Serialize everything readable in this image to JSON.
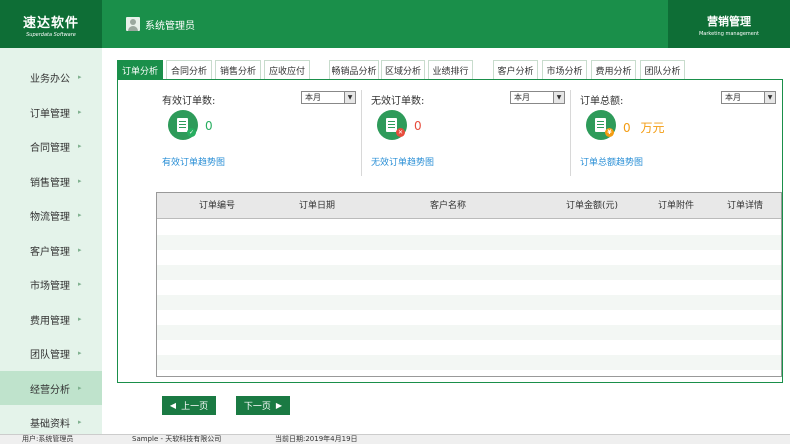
{
  "header": {
    "logo_title": "速达软件",
    "logo_subtitle": "Superdata Software",
    "user_label": "系统管理员",
    "module_title": "营销管理",
    "module_subtitle": "Marketing management"
  },
  "sidebar": {
    "items": [
      {
        "label": "业务办公",
        "active": false
      },
      {
        "label": "订单管理",
        "active": false
      },
      {
        "label": "合同管理",
        "active": false
      },
      {
        "label": "销售管理",
        "active": false
      },
      {
        "label": "物流管理",
        "active": false
      },
      {
        "label": "客户管理",
        "active": false
      },
      {
        "label": "市场管理",
        "active": false
      },
      {
        "label": "费用管理",
        "active": false
      },
      {
        "label": "团队管理",
        "active": false
      },
      {
        "label": "经营分析",
        "active": true
      },
      {
        "label": "基础资料",
        "active": false
      }
    ],
    "arrow": "▸"
  },
  "tabs": [
    {
      "label": "订单分析",
      "active": true
    },
    {
      "label": "合同分析",
      "active": false
    },
    {
      "label": "销售分析",
      "active": false
    },
    {
      "label": "应收应付",
      "active": false
    },
    {
      "label": "畅销品分析",
      "active": false
    },
    {
      "label": "区域分析",
      "active": false
    },
    {
      "label": "业绩排行",
      "active": false
    },
    {
      "label": "客户分析",
      "active": false
    },
    {
      "label": "市场分析",
      "active": false
    },
    {
      "label": "费用分析",
      "active": false
    },
    {
      "label": "团队分析",
      "active": false
    }
  ],
  "metrics": [
    {
      "label": "有效订单数:",
      "period": "本月",
      "value": "0",
      "unit": "",
      "link": "有效订单趋势图",
      "icon": "valid-order-icon",
      "badge": "✓",
      "value_color": "#27ae60"
    },
    {
      "label": "无效订单数:",
      "period": "本月",
      "value": "0",
      "unit": "",
      "link": "无效订单趋势图",
      "icon": "invalid-order-icon",
      "badge": "✕",
      "value_color": "#e74c3c"
    },
    {
      "label": "订单总额:",
      "period": "本月",
      "value": "0",
      "unit": "万元",
      "link": "订单总额趋势图",
      "icon": "order-amount-icon",
      "badge": "¥",
      "value_color": "#f39c12"
    }
  ],
  "dropdown_arrow": "▼",
  "table": {
    "columns": [
      "订单编号",
      "订单日期",
      "客户名称",
      "订单金额(元)",
      "订单附件",
      "订单详情"
    ],
    "rows": []
  },
  "pager": {
    "prev_label": "上一页",
    "next_label": "下一页",
    "prev_arrow": "◀",
    "next_arrow": "▶"
  },
  "statusbar": {
    "user": "用户:系统管理员",
    "company": "Sample - 天软科技有限公司",
    "date": "当前日期:2019年4月19日"
  },
  "colors": {
    "brand_green": "#1a8f4a",
    "dark_green": "#0e6e36",
    "sidebar_bg": "#e4f3ea",
    "link_blue": "#2a8fd6"
  }
}
